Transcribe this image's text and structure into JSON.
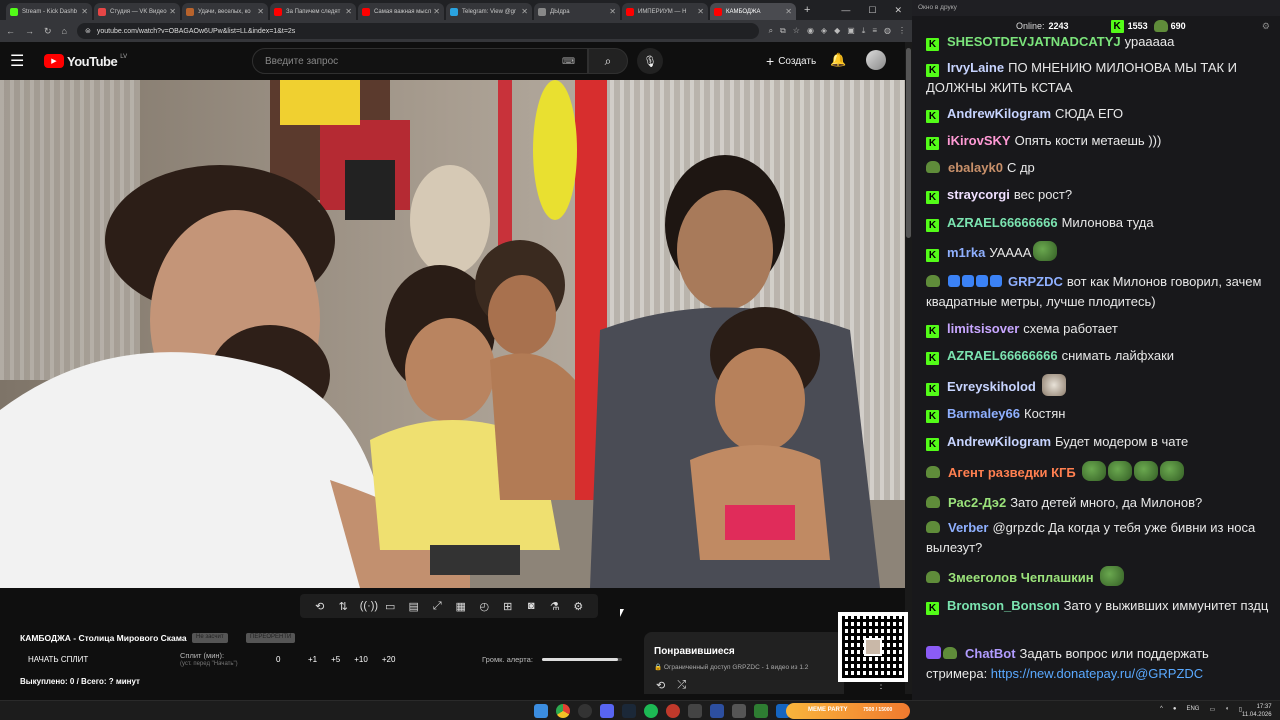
{
  "browser": {
    "tabs": [
      {
        "title": "Stream - Kick Dashb",
        "color": "#53fc18"
      },
      {
        "title": "Студия — VK Видео",
        "color": "#e64646"
      },
      {
        "title": "Удачи, веселых, ко",
        "color": "#b8632c"
      },
      {
        "title": "За Папичем следят",
        "color": "#ff0000"
      },
      {
        "title": "Самая важная мысл",
        "color": "#ff0000"
      },
      {
        "title": "Telegram: View @gr",
        "color": "#2aa3e0"
      },
      {
        "title": "ДЫдра",
        "color": "#888888"
      },
      {
        "title": "ИМПЕРИУМ — Н",
        "color": "#ff0000"
      },
      {
        "title": "КАМБОДЖА",
        "color": "#ff0000"
      }
    ],
    "url": "youtube.com/watch?v=OBAGAOw6UPw&list=LL&index=1&t=2s"
  },
  "youtube": {
    "logo_text": "YouTube",
    "country_code": "LV",
    "search_placeholder": "Введите запрос",
    "create_label": "Создать"
  },
  "panel": {
    "title": "КАМБОДЖА - Столица Мирового Скама",
    "chip1": "Не засчит",
    "chip2": "ПЕРЕОРЕНТИ",
    "start_split": "НАЧАТЬ СПЛИТ",
    "split_label": "Сплит (мин):",
    "split_sub": "(уст. перед \"Начать\")",
    "split_value": "0",
    "increments": [
      "+1",
      "+5",
      "+10",
      "+20"
    ],
    "bought": "Выкуплено: 0 / Всего: ? минут",
    "volume_label": "Громк. алерта:",
    "volume_level": 0.95
  },
  "liked": {
    "title": "Понравившиеся",
    "subtitle": "Ограниченный доступ   GRPZDC - 1 видео из 1.2"
  },
  "chat": {
    "header": "Окно в друку",
    "online_label": "Online:",
    "online_count": "2243",
    "stat1": "1553",
    "stat2": "690",
    "messages": [
      {
        "badge": "kick",
        "user": "SHESOTDEVJATNADCATYJ",
        "color": "#7be37b",
        "text": "урааааа"
      },
      {
        "badge": "kick",
        "user": "IrvyLaine",
        "color": "#c7d4ff",
        "text": "ПО МНЕНИЮ МИЛОНОВА МЫ ТАК И ДОЛЖНЫ ЖИТЬ КСТАА"
      },
      {
        "badge": "kick",
        "user": "AndrewKilogram",
        "color": "#c7d4ff",
        "text": "СЮДА ЕГО"
      },
      {
        "badge": "kick",
        "user": "iKirovSKY",
        "color": "#ff9ad5",
        "text": "Опять кости метаешь )))"
      },
      {
        "badge": "pepe",
        "user": "ebalayk0",
        "color": "#c8906a",
        "text": "С др"
      },
      {
        "badge": "kick",
        "user": "straycorgi",
        "color": "#f0e0ff",
        "text": "вес рост?"
      },
      {
        "badge": "kick",
        "user": "AZRAEL66666666",
        "color": "#7be3b0",
        "text": "Милонова туда"
      },
      {
        "badge": "kick",
        "user": "m1rka",
        "color": "#8fb0ff",
        "text": "УАААА"
      },
      {
        "badge": "pepe",
        "user": "GRPZDC",
        "color": "#8fb0ff",
        "text": "вот как Милонов говорил, зачем квадратные метры, лучше плодитесь)"
      },
      {
        "badge": "kick",
        "user": "limitsisover",
        "color": "#c7a6ff",
        "text": "схема работает"
      },
      {
        "badge": "kick",
        "user": "AZRAEL66666666",
        "color": "#7be3b0",
        "text": "снимать лайфхаки"
      },
      {
        "badge": "kick",
        "user": "Evreyskiholod",
        "color": "#c7d4ff",
        "text": ""
      },
      {
        "badge": "kick",
        "user": "Barmaley66",
        "color": "#8fb0ff",
        "text": "Костян"
      },
      {
        "badge": "kick",
        "user": "AndrewKilogram",
        "color": "#c7d4ff",
        "text": "Будет модером в чате"
      },
      {
        "badge": "pepe",
        "user": "Агент разведки КГБ",
        "color": "#ff7f50",
        "text": ""
      },
      {
        "badge": "pepe",
        "user": "Рас2-Дэ2",
        "color": "#9be37b",
        "text": "Зато детей много, да Милонов?"
      },
      {
        "badge": "pepe",
        "user": "Verber",
        "color": "#8fb0ff",
        "text": "@grpzdc Да когда у тебя уже бивни из носа вылезут?"
      },
      {
        "badge": "pepe",
        "user": "Змееголов Чеплашкин",
        "color": "#9be37b",
        "text": ""
      },
      {
        "badge": "kick",
        "user": "Bromson_Bonson",
        "color": "#7be3b0",
        "text": "Зато у выживших иммунитет пздц"
      },
      {
        "badge": "bot",
        "user": "ChatBot",
        "color": "#b19cff",
        "text": "Задать вопрос или поддержать стримера: ",
        "link": "https://new.donatepay.ru/@GRPZDC"
      }
    ]
  },
  "taskbar": {
    "meme_label": "MEME PARTY",
    "meme_sub": "7500 / 15000",
    "lang": "ENG",
    "time": "17:37",
    "date": "11.04.2026"
  }
}
